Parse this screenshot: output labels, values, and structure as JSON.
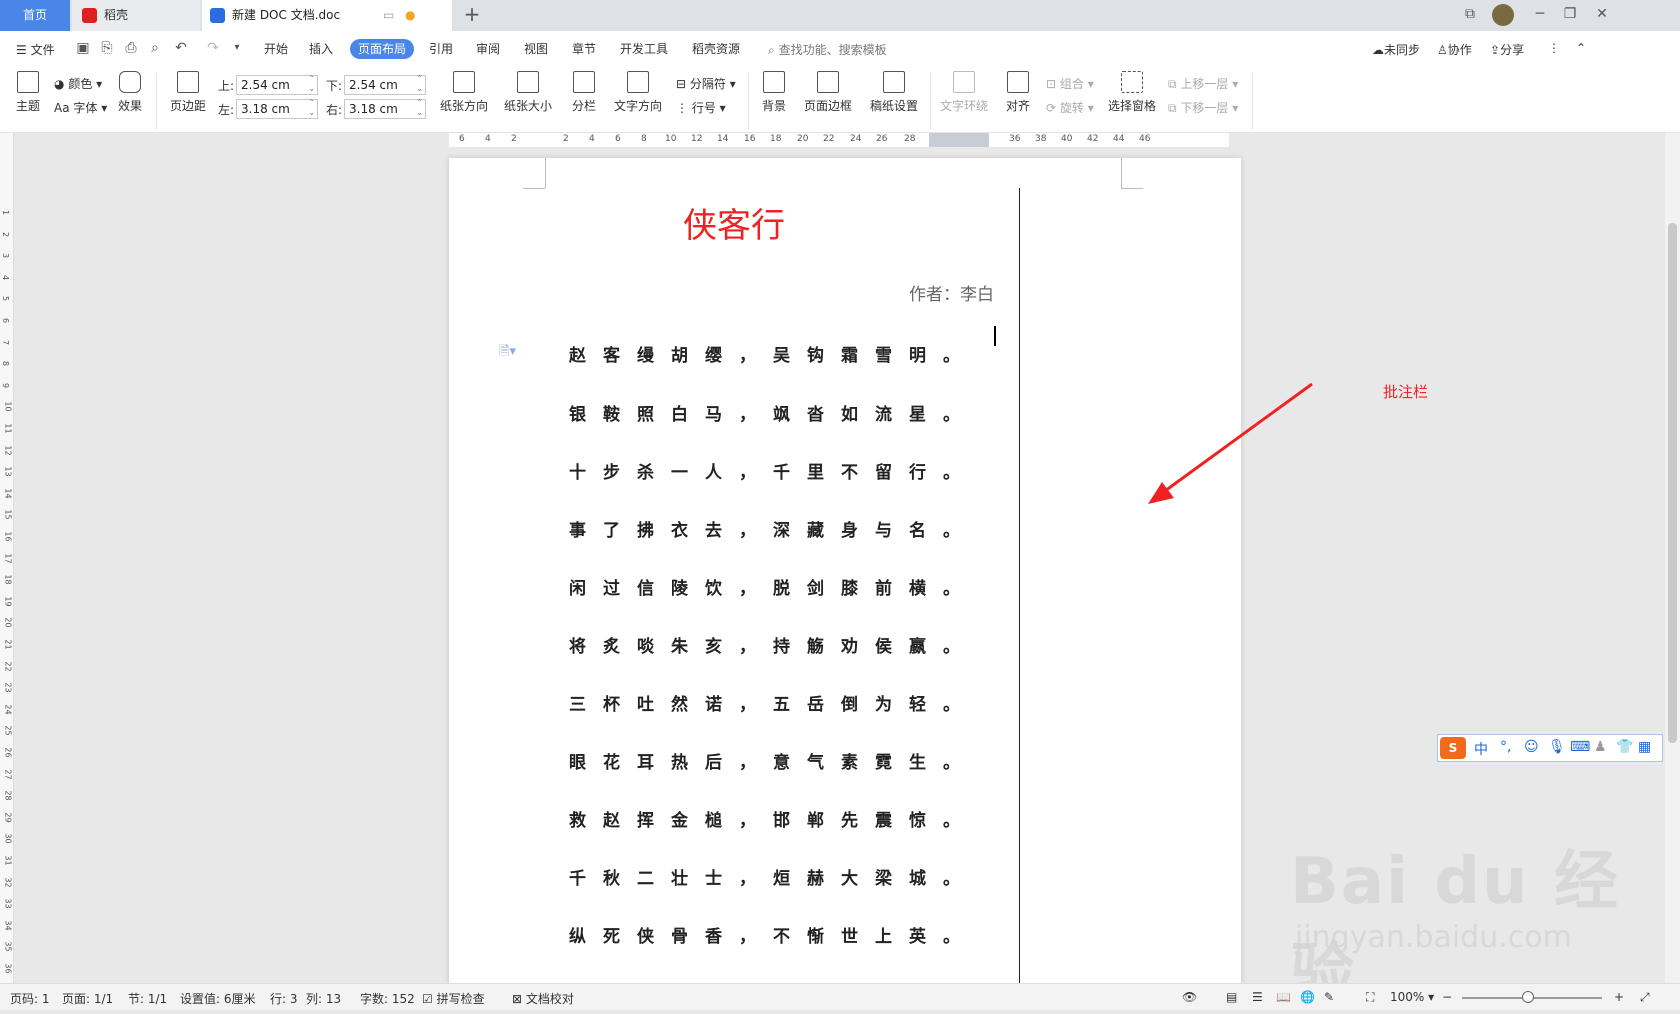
{
  "tabs": {
    "home": "首页",
    "daoke": "稻壳",
    "doc": "新建 DOC 文档.doc",
    "plus": "+"
  },
  "menubar": {
    "file": "文件",
    "tabs": [
      "开始",
      "插入",
      "页面布局",
      "引用",
      "审阅",
      "视图",
      "章节",
      "开发工具",
      "稻壳资源"
    ],
    "active": "页面布局",
    "search": "查找功能、搜索模板",
    "sync": "未同步",
    "collab": "协作",
    "share": "分享"
  },
  "ribbon": {
    "theme": "主题",
    "color": "颜色",
    "font": "Aa 字体",
    "effect": "效果",
    "margins": "页边距",
    "top_label": "上:",
    "top_val": "2.54 cm",
    "bottom_label": "下:",
    "bottom_val": "2.54 cm",
    "left_label": "左:",
    "left_val": "3.18 cm",
    "right_label": "右:",
    "right_val": "3.18 cm",
    "orientation": "纸张方向",
    "size": "纸张大小",
    "columns": "分栏",
    "textdir": "文字方向",
    "breaks": "分隔符",
    "lineno": "行号",
    "background": "背景",
    "border": "页面边框",
    "manuscript": "稿纸设置",
    "wrap": "文字环绕",
    "align": "对齐",
    "group": "组合",
    "rotate": "旋转",
    "pane": "选择窗格",
    "forward": "上移一层",
    "backward": "下移一层"
  },
  "ruler": [
    "6",
    "4",
    "2",
    "2",
    "4",
    "6",
    "8",
    "10",
    "12",
    "14",
    "16",
    "18",
    "20",
    "22",
    "24",
    "26",
    "28",
    "36",
    "38",
    "40",
    "42",
    "44",
    "46"
  ],
  "document": {
    "title": "侠客行",
    "author": "作者：李白",
    "lines": [
      "赵客缦胡缨，吴钩霜雪明。",
      "银鞍照白马，飒沓如流星。",
      "十步杀一人，千里不留行。",
      "事了拂衣去，深藏身与名。",
      "闲过信陵饮，脱剑膝前横。",
      "将炙啖朱亥，持觞劝侯嬴。",
      "三杯吐然诺，五岳倒为轻。",
      "眼花耳热后，意气素霓生。",
      "救赵挥金槌，邯郸先震惊。",
      "千秋二壮士，烜赫大梁城。",
      "纵死侠骨香，不惭世上英。"
    ]
  },
  "annotation": "批注栏",
  "status": {
    "page": "页码: 1",
    "pages": "页面: 1/1",
    "section": "节: 1/1",
    "setting": "设置值: 6厘米",
    "row": "行: 3",
    "col": "列: 13",
    "words": "字数: 152",
    "spell": "拼写检查",
    "proof": "文档校对",
    "zoom": "100%"
  },
  "ime": "中",
  "watermark": "Bai du 经验",
  "watermark_url": "jingyan.baidu.com",
  "colors": {
    "accent": "#4a86e8",
    "title": "#e22222"
  }
}
